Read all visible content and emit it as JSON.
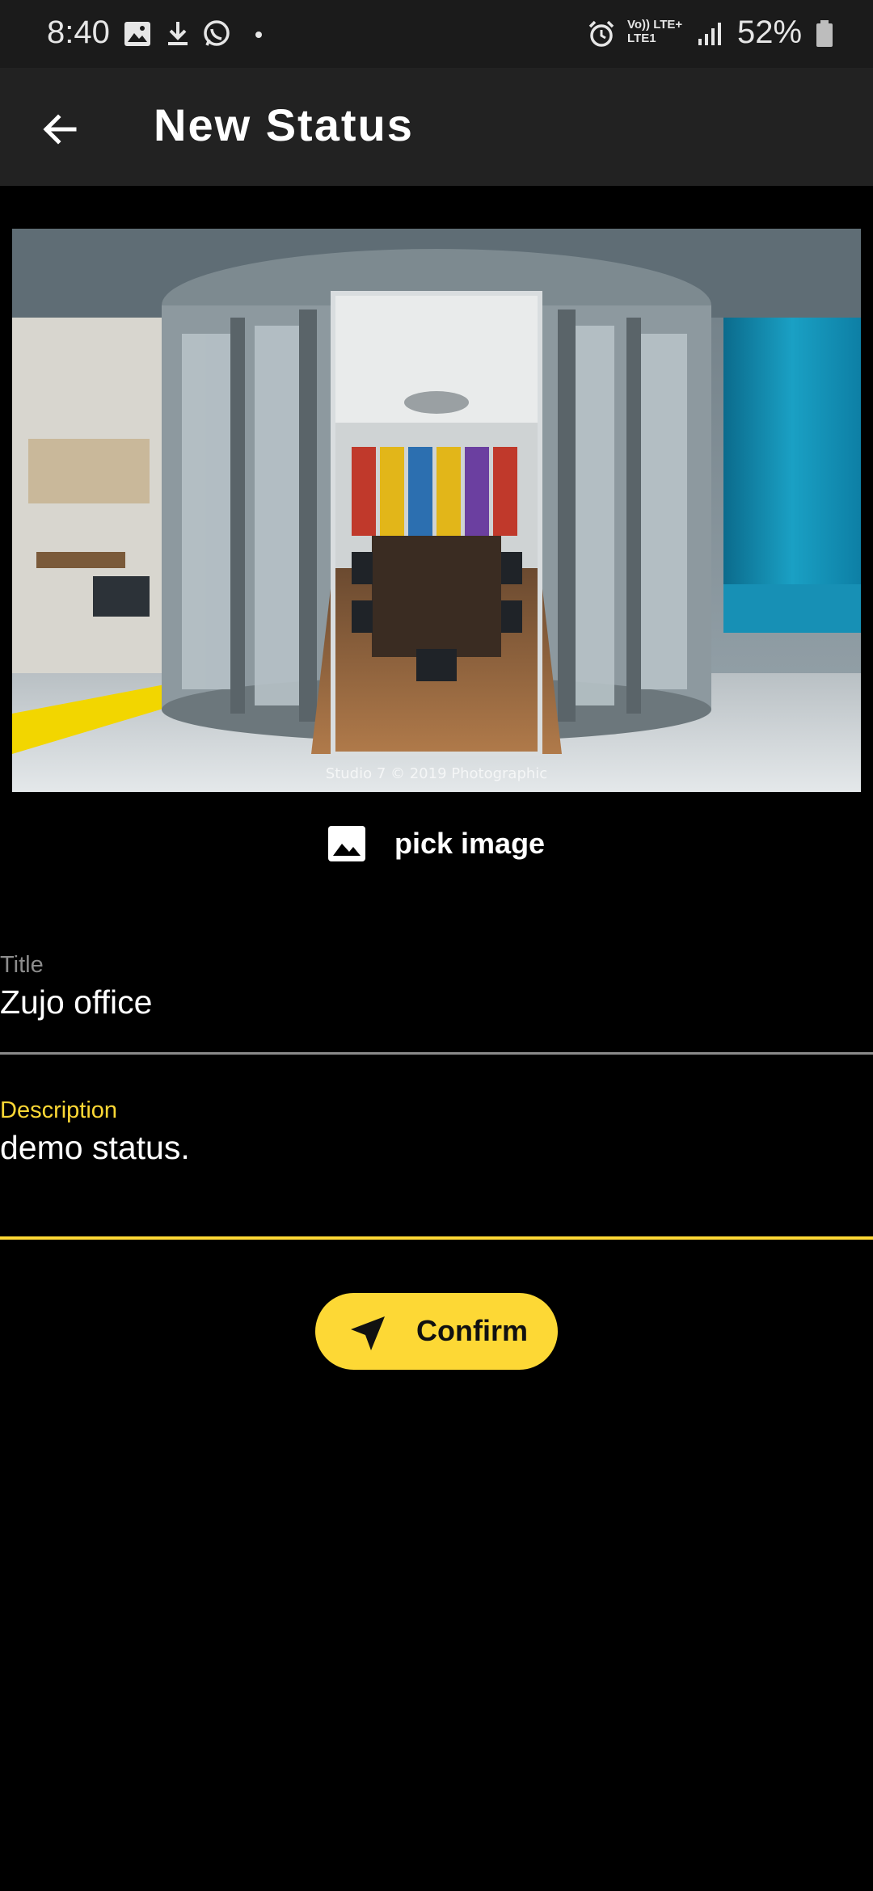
{
  "status_bar": {
    "time": "8:40",
    "network_top": "Vo)) LTE+",
    "network_bottom": "LTE1",
    "battery": "52%",
    "icons": [
      "gallery-icon",
      "download-icon",
      "whatsapp-icon",
      "dot-icon",
      "alarm-icon",
      "signal-icon",
      "battery-icon"
    ]
  },
  "app_bar": {
    "title": "New Status",
    "back_icon": "arrow-left-icon"
  },
  "preview": {
    "watermark": "Studio 7 © 2019 Photographic"
  },
  "pick_image": {
    "label": "pick image",
    "icon": "image-icon"
  },
  "form": {
    "title_label": "Title",
    "title_value": "Zujo office",
    "description_label": "Description",
    "description_value": "demo status."
  },
  "confirm": {
    "label": "Confirm",
    "icon": "send-arrow-icon"
  },
  "colors": {
    "accent": "#fdd835",
    "background": "#000000",
    "app_bar": "#222222",
    "status_bar": "#1b1b1b"
  }
}
